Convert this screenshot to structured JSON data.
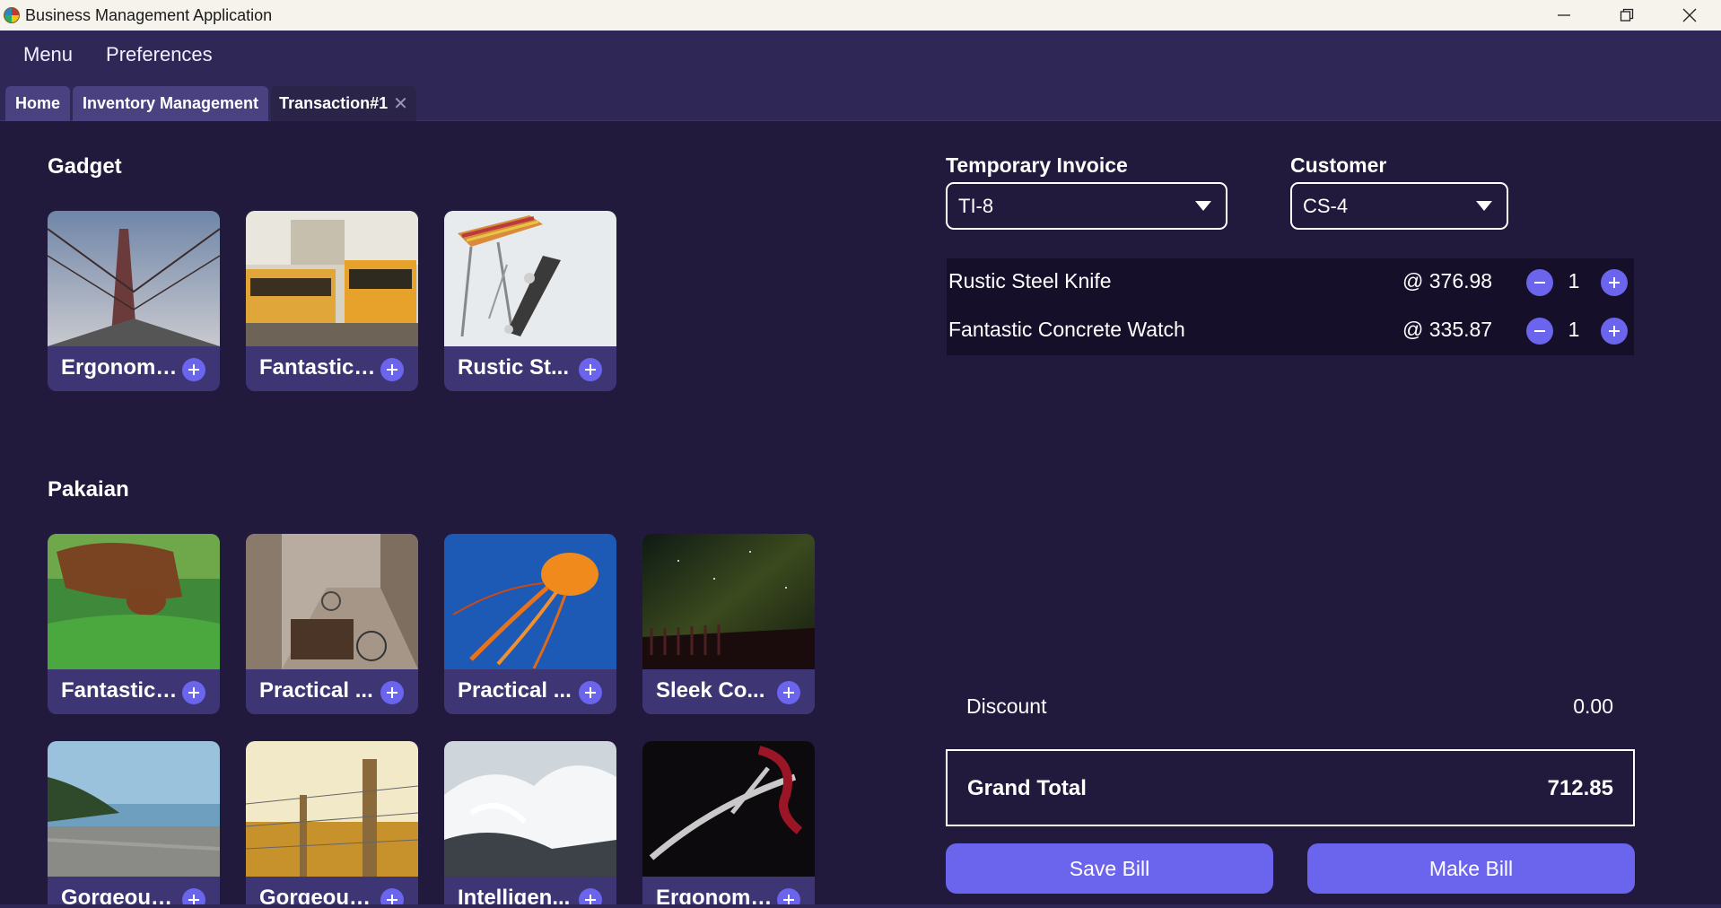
{
  "window": {
    "title": "Business Management Application"
  },
  "menu": {
    "items": [
      "Menu",
      "Preferences"
    ]
  },
  "tabs": [
    {
      "label": "Home"
    },
    {
      "label": "Inventory Management"
    },
    {
      "label": "Transaction#1",
      "closable": true
    }
  ],
  "categories": [
    {
      "title": "Gadget",
      "products": [
        {
          "name": "Ergonomi...",
          "image": "bridge-photo"
        },
        {
          "name": "Fantastic ...",
          "image": "trams-photo"
        },
        {
          "name": "Rustic St...",
          "image": "chair-photo"
        }
      ]
    },
    {
      "title": "Pakaian",
      "products": [
        {
          "name": "Fantastic ...",
          "image": "dog-photo"
        },
        {
          "name": "Practical ...",
          "image": "bicycles-photo"
        },
        {
          "name": "Practical ...",
          "image": "jellyfish-photo"
        },
        {
          "name": "Sleek Co...",
          "image": "night-sky-photo"
        },
        {
          "name": "Gorgeous...",
          "image": "beach-photo"
        },
        {
          "name": "Gorgeous...",
          "image": "fence-photo"
        },
        {
          "name": "Intelligen...",
          "image": "waves-photo"
        },
        {
          "name": "Ergonomi...",
          "image": "antler-photo"
        }
      ]
    }
  ],
  "invoice": {
    "temporary_invoice_label": "Temporary Invoice",
    "temporary_invoice_value": "TI-8",
    "customer_label": "Customer",
    "customer_value": "CS-4",
    "lines": [
      {
        "name": "Rustic Steel Knife",
        "price": "@ 376.98",
        "qty": "1"
      },
      {
        "name": "Fantastic Concrete Watch",
        "price": "@ 335.87",
        "qty": "1"
      }
    ],
    "discount_label": "Discount",
    "discount_value": "0.00",
    "grand_total_label": "Grand Total",
    "grand_total_value": "712.85",
    "save_label": "Save Bill",
    "make_label": "Make Bill"
  },
  "colors": {
    "accent": "#6b64ec",
    "background": "#211a3c",
    "header": "#2f2857",
    "card": "#3e3674"
  }
}
